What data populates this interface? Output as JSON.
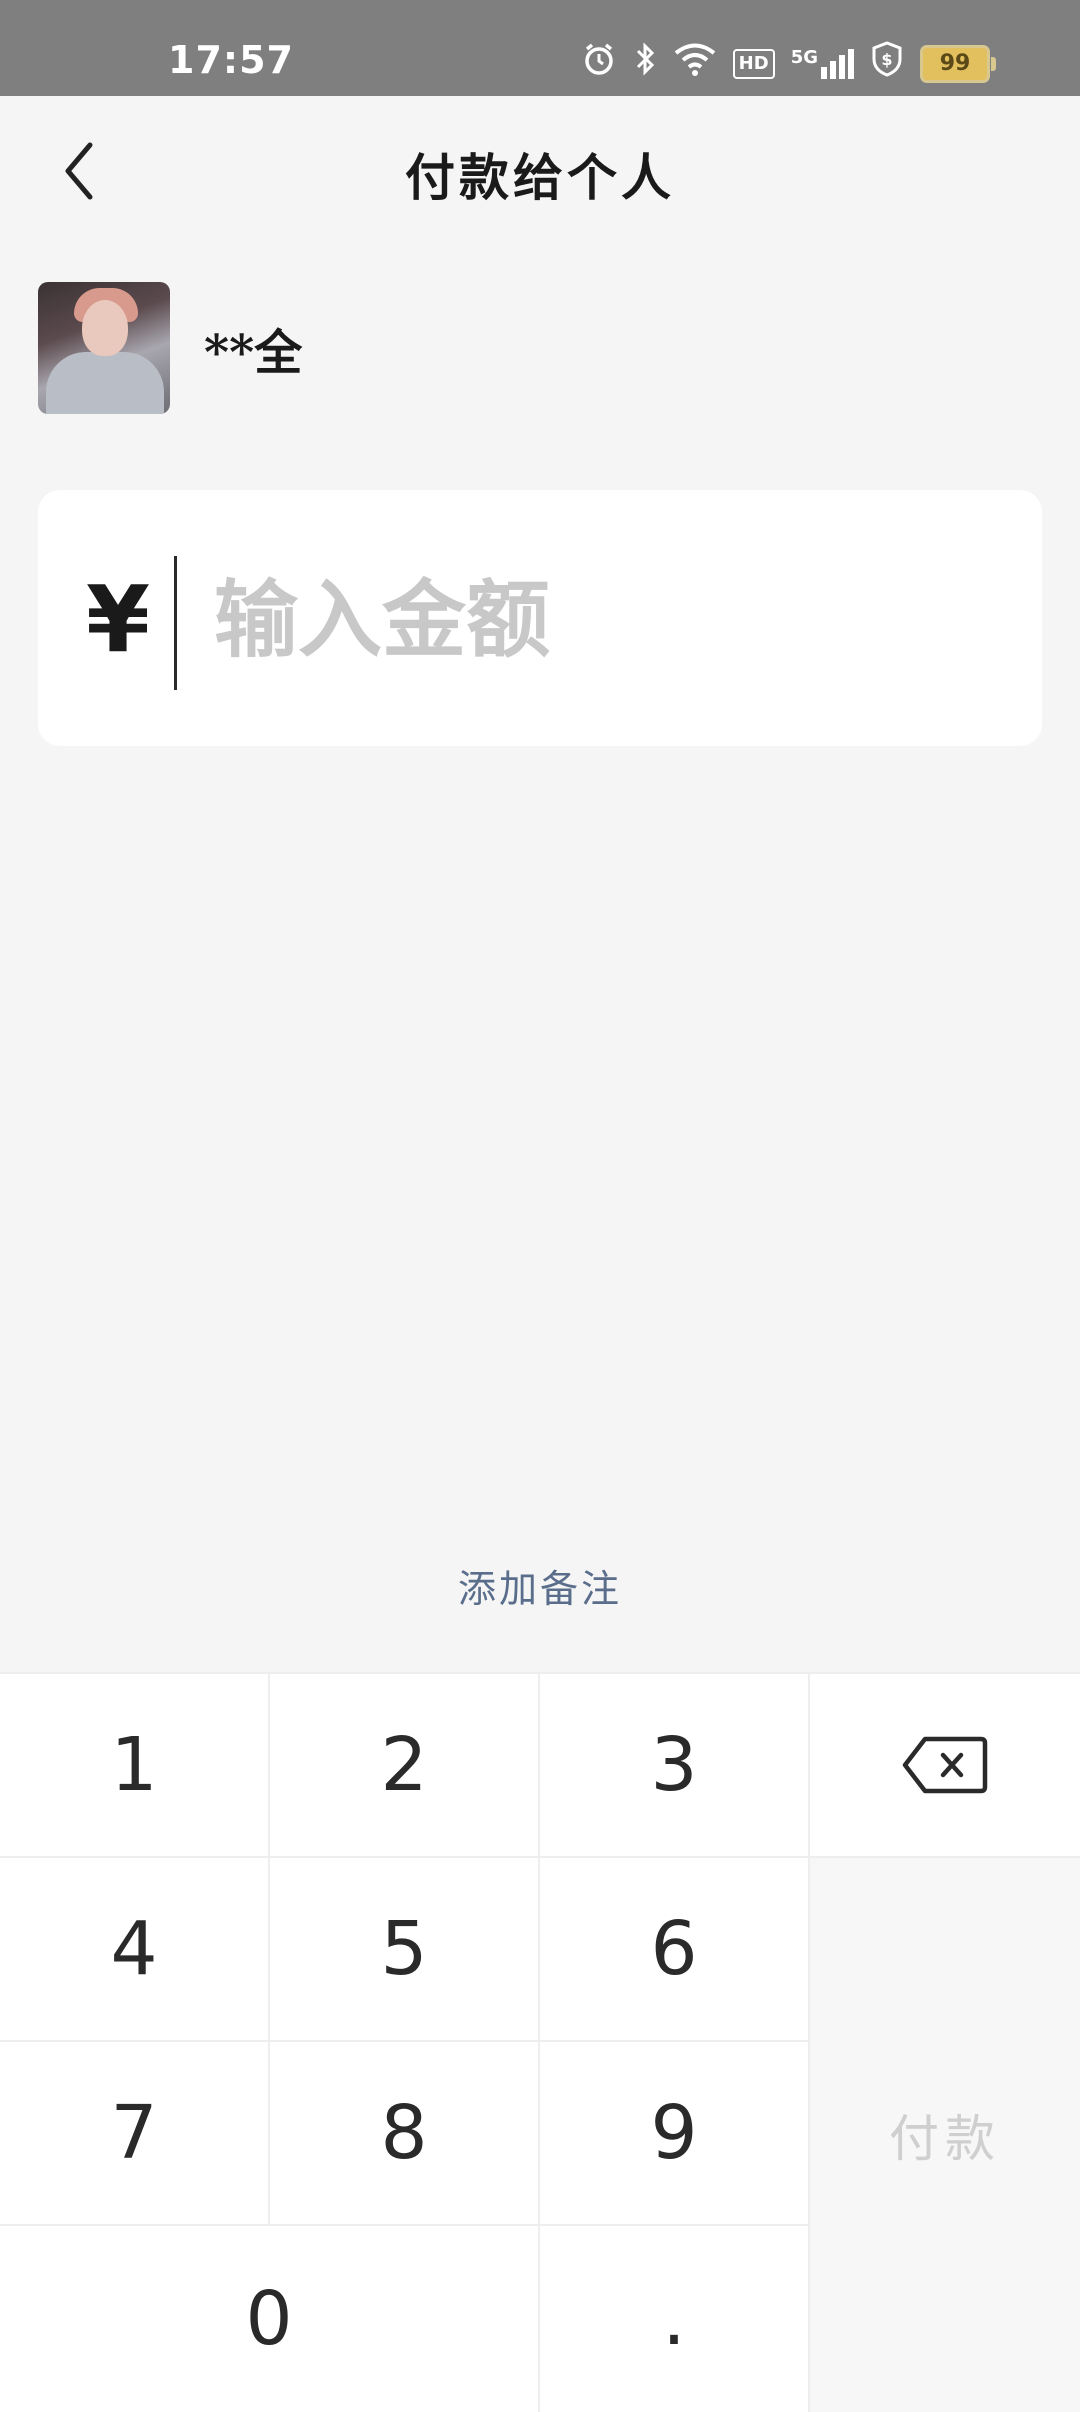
{
  "status_bar": {
    "time": "17:57",
    "network": "5G",
    "hd_label": "HD",
    "battery": "99",
    "icons": [
      "alarm-icon",
      "bluetooth-icon",
      "wifi-icon",
      "hd-icon",
      "signal-5g-icon",
      "security-shield-icon",
      "battery-icon"
    ]
  },
  "nav": {
    "title": "付款给个人",
    "back_icon": "chevron-left-icon"
  },
  "recipient": {
    "name": "**全"
  },
  "amount": {
    "currency_symbol": "¥",
    "placeholder": "输入金额",
    "value": ""
  },
  "note": {
    "label": "添加备注"
  },
  "keypad": {
    "keys": [
      "1",
      "2",
      "3",
      "4",
      "5",
      "6",
      "7",
      "8",
      "9",
      "0",
      "."
    ],
    "backspace_icon": "backspace-icon",
    "pay_label": "付款"
  },
  "colors": {
    "background": "#f5f5f5",
    "status_bar": "#7f7f7f",
    "note_link": "#5a6e8c",
    "pay_disabled_text": "#cfcfcf"
  }
}
